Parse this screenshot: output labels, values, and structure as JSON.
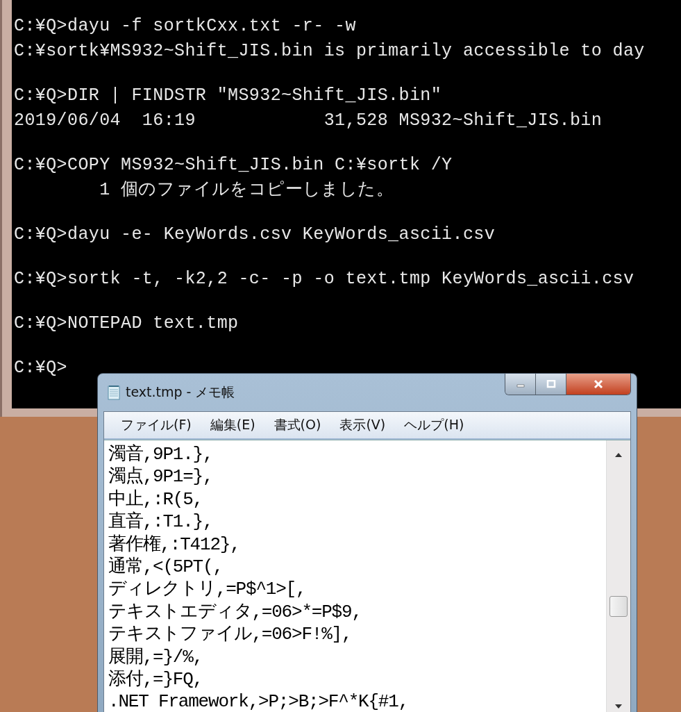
{
  "console": {
    "blocks": [
      {
        "lines": [
          "C:¥Q>dayu -f sortkCxx.txt -r- -w",
          "C:¥sortk¥MS932~Shift_JIS.bin is primarily accessible to day"
        ]
      },
      {
        "lines": [
          "C:¥Q>DIR | FINDSTR \"MS932~Shift_JIS.bin\"",
          "2019/06/04  16:19            31,528 MS932~Shift_JIS.bin"
        ]
      },
      {
        "lines": [
          "C:¥Q>COPY MS932~Shift_JIS.bin C:¥sortk /Y",
          "        1 個のファイルをコピーしました。"
        ]
      },
      {
        "lines": [
          "C:¥Q>dayu -e- KeyWords.csv KeyWords_ascii.csv"
        ]
      },
      {
        "lines": [
          "C:¥Q>sortk -t, -k2,2 -c- -p -o text.tmp KeyWords_ascii.csv"
        ]
      },
      {
        "lines": [
          "C:¥Q>NOTEPAD text.tmp"
        ]
      },
      {
        "lines": [
          "C:¥Q>"
        ]
      }
    ]
  },
  "notepad": {
    "title": "text.tmp - メモ帳",
    "menu": [
      "ファイル(F)",
      "編集(E)",
      "書式(O)",
      "表示(V)",
      "ヘルプ(H)"
    ],
    "lines": [
      "濁音,9P1.},",
      "濁点,9P1=},",
      "中止,:R(5,",
      "直音,:T1.},",
      "著作権,:T412},",
      "通常,<(5PT(,",
      "ディレクトリ,=P$^1>[,",
      "テキストエディタ,=06>*=P$9,",
      "テキストファイル,=06>F!%],",
      "展開,=}/%,",
      "添付,=}FQ,",
      ".NET Framework,>P;>B;>F^*K{#1,"
    ]
  }
}
